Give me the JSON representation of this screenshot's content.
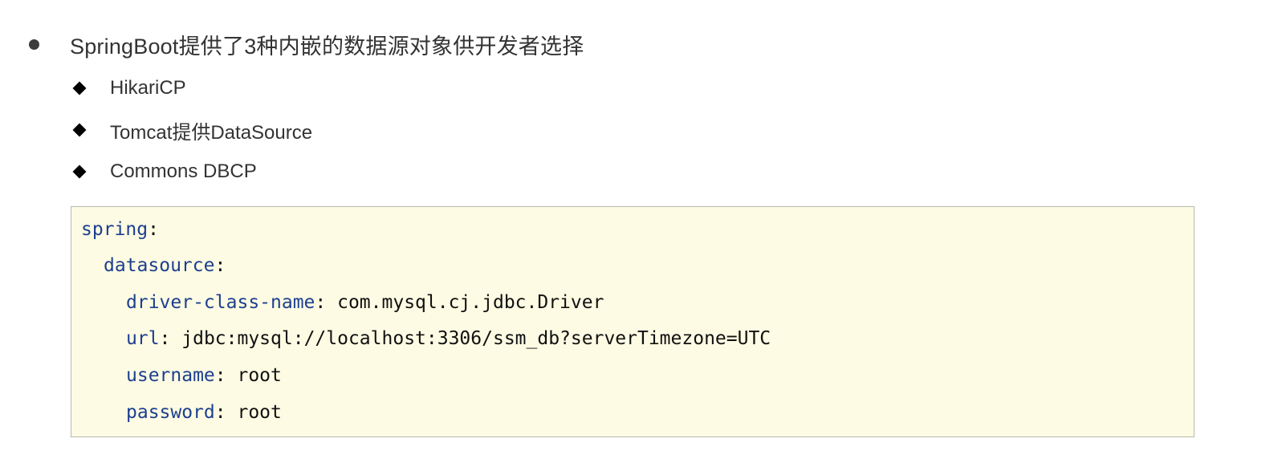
{
  "main_bullet": {
    "text": "SpringBoot提供了3种内嵌的数据源对象供开发者选择"
  },
  "sub_items": [
    {
      "text": "HikariCP"
    },
    {
      "text": "Tomcat提供DataSource"
    },
    {
      "text": "Commons DBCP"
    }
  ],
  "code_block": {
    "background": "#fdfbe3",
    "key_color": "#1d3f8f",
    "lines": [
      {
        "key": "spring",
        "sep": ":",
        "value": ""
      },
      {
        "key": "datasource",
        "sep": ":",
        "value": ""
      },
      {
        "key": "driver-class-name",
        "sep": ":",
        "value": " com.mysql.cj.jdbc.Driver"
      },
      {
        "key": "url",
        "sep": ":",
        "value": " jdbc:mysql://localhost:3306/ssm_db?serverTimezone=UTC"
      },
      {
        "key": "username",
        "sep": ":",
        "value": " root"
      },
      {
        "key": "password",
        "sep": ":",
        "value": " root"
      }
    ]
  }
}
